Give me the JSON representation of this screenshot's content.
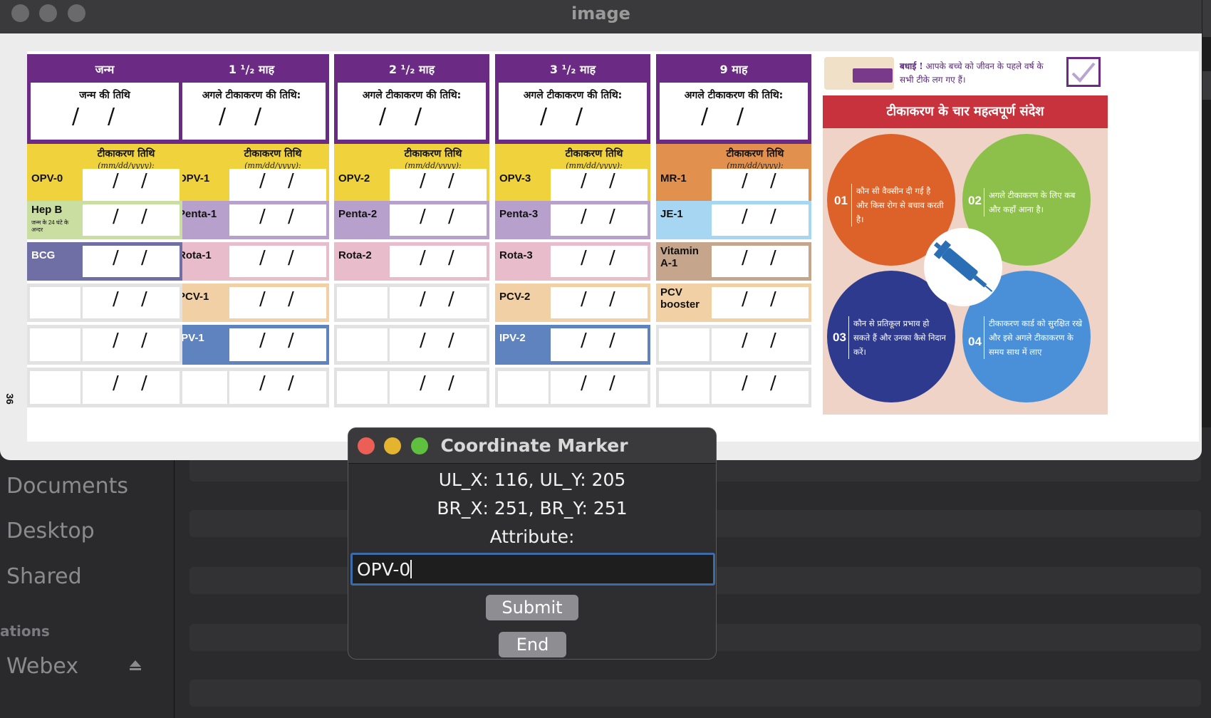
{
  "image_window": {
    "title": "image",
    "page_number": "36",
    "columns": [
      {
        "header": "जन्म",
        "date_label": "जन्म की तिथि",
        "vax_date_label": "टीकाकरण तिथि",
        "date_format": "(mm/dd/yyyy):",
        "header_color": "#6b2a84",
        "rows": [
          {
            "label": "OPV-0",
            "color": "#f0d23c",
            "sub": ""
          },
          {
            "label": "Hep B",
            "color": "#c9dea0",
            "sub": "जन्म के 24 घंटे के अन्दर"
          },
          {
            "label": "BCG",
            "color": "#6f6fa6",
            "sub": ""
          },
          {
            "label": "",
            "color": "#e2e2e2",
            "sub": ""
          },
          {
            "label": "",
            "color": "#e2e2e2",
            "sub": ""
          },
          {
            "label": "",
            "color": "#e2e2e2",
            "sub": ""
          }
        ]
      },
      {
        "header": "1 ¹/₂ माह",
        "date_label": "अगले टीकाकरण की तिथि:",
        "vax_date_label": "टीकाकरण तिथि",
        "date_format": "(mm/dd/yyyy):",
        "header_color": "#6b2a84",
        "rows": [
          {
            "label": "OPV-1",
            "color": "#f0d23c"
          },
          {
            "label": "Penta-1",
            "color": "#b8a0cc"
          },
          {
            "label": "Rota-1",
            "color": "#e8bccb"
          },
          {
            "label": "PCV-1",
            "color": "#f2d0a6"
          },
          {
            "label": "IPV-1",
            "color": "#5f83be"
          },
          {
            "label": "",
            "color": "#e2e2e2"
          }
        ]
      },
      {
        "header": "2 ¹/₂ माह",
        "date_label": "अगले टीकाकरण की तिथि:",
        "vax_date_label": "टीकाकरण तिथि",
        "date_format": "(mm/dd/yyyy):",
        "header_color": "#6b2a84",
        "rows": [
          {
            "label": "OPV-2",
            "color": "#f0d23c"
          },
          {
            "label": "Penta-2",
            "color": "#b8a0cc"
          },
          {
            "label": "Rota-2",
            "color": "#e8bccb"
          },
          {
            "label": "",
            "color": "#e2e2e2"
          },
          {
            "label": "",
            "color": "#e2e2e2"
          },
          {
            "label": "",
            "color": "#e2e2e2"
          }
        ]
      },
      {
        "header": "3 ¹/₂ माह",
        "date_label": "अगले टीकाकरण की तिथि:",
        "vax_date_label": "टीकाकरण तिथि",
        "date_format": "(mm/dd/yyyy):",
        "header_color": "#6b2a84",
        "rows": [
          {
            "label": "OPV-3",
            "color": "#f0d23c"
          },
          {
            "label": "Penta-3",
            "color": "#b8a0cc"
          },
          {
            "label": "Rota-3",
            "color": "#e8bccb"
          },
          {
            "label": "PCV-2",
            "color": "#f2d0a6"
          },
          {
            "label": "IPV-2",
            "color": "#5f83be"
          },
          {
            "label": "",
            "color": "#e2e2e2"
          }
        ]
      },
      {
        "header": "9 माह",
        "date_label": "अगले टीकाकरण की तिथि:",
        "vax_date_label": "टीकाकरण तिथि",
        "date_format": "(mm/dd/yyyy):",
        "header_color": "#6b2a84",
        "rows": [
          {
            "label": "MR-1",
            "color": "#e2904e"
          },
          {
            "label": "JE-1",
            "color": "#a6d6f2"
          },
          {
            "label": "Vitamin A-1",
            "color": "#c5a58c"
          },
          {
            "label": "PCV booster",
            "color": "#f2d0a6"
          },
          {
            "label": "",
            "color": "#e2e2e2"
          },
          {
            "label": "",
            "color": "#e2e2e2"
          }
        ]
      }
    ],
    "info_panel": {
      "congrats_title": "बधाई !",
      "congrats_text": "आपके बच्चे को जीवन के पहले वर्ष के सभी टीके लग गए हैं।",
      "banner": "टीकाकरण के चार महत्वपूर्ण संदेश",
      "messages": [
        {
          "num": "01",
          "text": "कौन सी वैक्सीन दी गई है और किस रोग से बचाव करती है।",
          "color": "#dd6229"
        },
        {
          "num": "02",
          "text": "अगले टीकाकरण के लिए कब और कहाँ आना है।",
          "color": "#8cc04a"
        },
        {
          "num": "03",
          "text": "कौन से प्रतिकूल प्रभाव हो सकते हैं और उनका कैसे निदान करें।",
          "color": "#2d3a8e"
        },
        {
          "num": "04",
          "text": "टीकाकरण कार्ड को सुरक्षित रखे और इसे अगले टीकाकरण के समय साथ में लाए",
          "color": "#4a90d9"
        }
      ]
    }
  },
  "sidebar": {
    "items": [
      "Documents",
      "Desktop",
      "Shared"
    ],
    "section": "ations",
    "location": "Webex"
  },
  "coordinate_marker": {
    "title": "Coordinate Marker",
    "line1": "UL_X: 116, UL_Y: 205",
    "line2": "BR_X: 251, BR_Y: 251",
    "attribute_label": "Attribute:",
    "attribute_value": "OPV-0",
    "submit_label": "Submit",
    "end_label": "End"
  }
}
